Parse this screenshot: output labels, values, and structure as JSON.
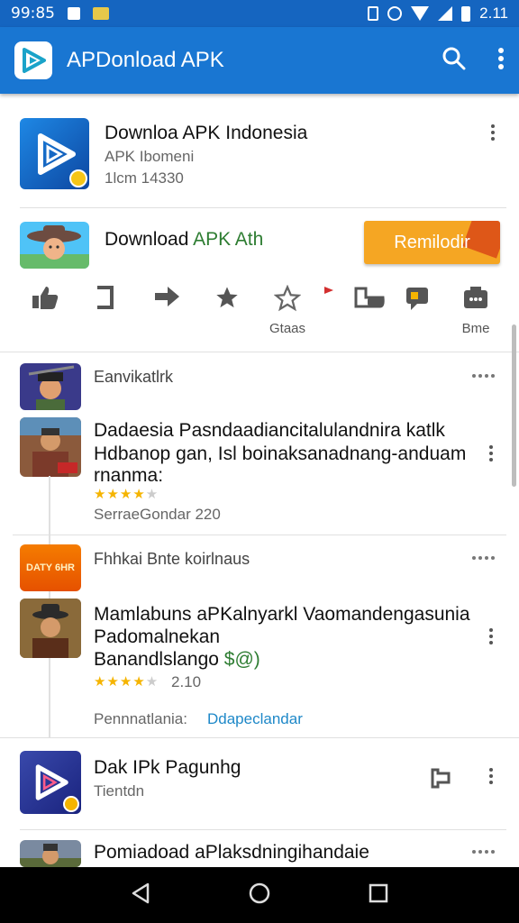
{
  "status_bar": {
    "time": "99:85",
    "clock": "2.11"
  },
  "app_bar": {
    "title": "APDonload APK"
  },
  "featured": {
    "title": "Downloa APK Indonesia",
    "subtitle": "APK Ibomeni",
    "meta": "1lcm 14330"
  },
  "promo": {
    "title_black": "Download ",
    "title_green": "APK Ath",
    "button_label": "Remilodir"
  },
  "actions": [
    {
      "icon": "thumbs-up-icon",
      "label": ""
    },
    {
      "icon": "bracket-icon",
      "label": ""
    },
    {
      "icon": "share-arrow-icon",
      "label": ""
    },
    {
      "icon": "star-filled-icon",
      "label": ""
    },
    {
      "icon": "star-outline-icon",
      "label": "Gtaas"
    },
    {
      "icon": "flag-icon",
      "label": ""
    },
    {
      "icon": "folder-icon",
      "label": ""
    },
    {
      "icon": "comment-icon",
      "label": ""
    },
    {
      "icon": "more-box-icon",
      "label": "Bme"
    }
  ],
  "section1": {
    "header": "Eanvikatlrk",
    "title_line1": "Dadaesia Pasndaadiancitalulandnira katlk",
    "title_line2": "Hdbanop gan, Isl boinaksanadnang-anduam",
    "title_line3": "rnanma:",
    "rating": 4.5,
    "footer": "SerraeGondar  220"
  },
  "section2": {
    "header": "Fhhkai Bnte koirlnaus",
    "badge_text": "DATY 6HR",
    "title_line1": "Mamlabuns aPKalnyarkl Vaomandengasunia",
    "title_line2": "Padomalnekan",
    "title_line3_a": "Banandlslango ",
    "title_line3_b": "$@)",
    "rating": 4.5,
    "rating_count": "2.10",
    "footer_label": "Pennnatlania:",
    "footer_link": "Ddapeclandar"
  },
  "item3": {
    "title": "Dak IPk Pagunhg",
    "subtitle": "Tientdn"
  },
  "item4": {
    "title": "Pomiadoad aPlaksdningihandaie"
  },
  "colors": {
    "primary": "#1976d2",
    "accent": "#f5a623",
    "green": "#2e7d32",
    "link": "#1e88c8"
  }
}
